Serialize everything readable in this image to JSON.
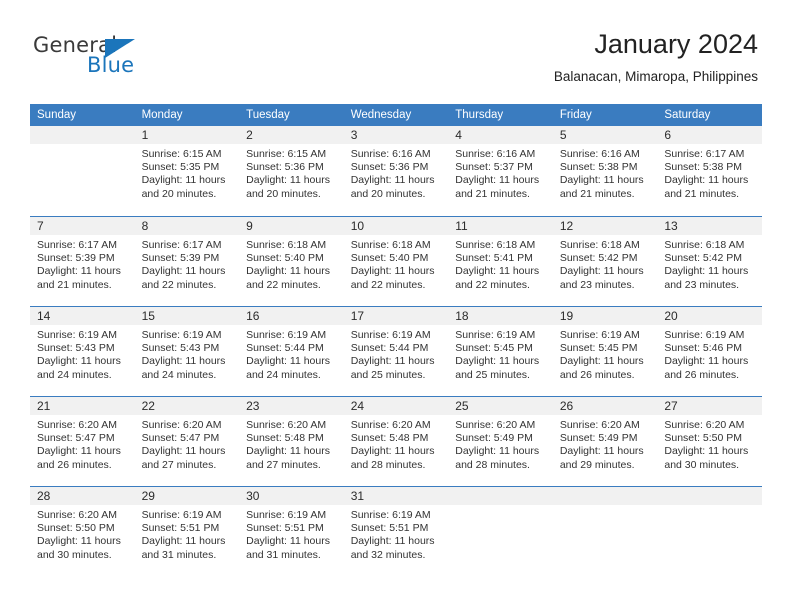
{
  "brand": {
    "name_top": "General",
    "name_bottom": "Blue",
    "triangle_icon": "triangle-icon",
    "accent_color": "#1b75bb"
  },
  "header": {
    "title": "January 2024",
    "subtitle": "Balanacan, Mimaropa, Philippines"
  },
  "theme": {
    "header_row_bg": "#3a7cc0",
    "daynum_band_bg": "#f1f1f1",
    "grid_line": "#3a7cc0",
    "text": "#333333"
  },
  "calendar": {
    "weekday_headers": [
      "Sunday",
      "Monday",
      "Tuesday",
      "Wednesday",
      "Thursday",
      "Friday",
      "Saturday"
    ],
    "weeks": [
      [
        {
          "day": "",
          "lines": []
        },
        {
          "day": "1",
          "lines": [
            "Sunrise: 6:15 AM",
            "Sunset: 5:35 PM",
            "Daylight: 11 hours",
            "and 20 minutes."
          ]
        },
        {
          "day": "2",
          "lines": [
            "Sunrise: 6:15 AM",
            "Sunset: 5:36 PM",
            "Daylight: 11 hours",
            "and 20 minutes."
          ]
        },
        {
          "day": "3",
          "lines": [
            "Sunrise: 6:16 AM",
            "Sunset: 5:36 PM",
            "Daylight: 11 hours",
            "and 20 minutes."
          ]
        },
        {
          "day": "4",
          "lines": [
            "Sunrise: 6:16 AM",
            "Sunset: 5:37 PM",
            "Daylight: 11 hours",
            "and 21 minutes."
          ]
        },
        {
          "day": "5",
          "lines": [
            "Sunrise: 6:16 AM",
            "Sunset: 5:38 PM",
            "Daylight: 11 hours",
            "and 21 minutes."
          ]
        },
        {
          "day": "6",
          "lines": [
            "Sunrise: 6:17 AM",
            "Sunset: 5:38 PM",
            "Daylight: 11 hours",
            "and 21 minutes."
          ]
        }
      ],
      [
        {
          "day": "7",
          "lines": [
            "Sunrise: 6:17 AM",
            "Sunset: 5:39 PM",
            "Daylight: 11 hours",
            "and 21 minutes."
          ]
        },
        {
          "day": "8",
          "lines": [
            "Sunrise: 6:17 AM",
            "Sunset: 5:39 PM",
            "Daylight: 11 hours",
            "and 22 minutes."
          ]
        },
        {
          "day": "9",
          "lines": [
            "Sunrise: 6:18 AM",
            "Sunset: 5:40 PM",
            "Daylight: 11 hours",
            "and 22 minutes."
          ]
        },
        {
          "day": "10",
          "lines": [
            "Sunrise: 6:18 AM",
            "Sunset: 5:40 PM",
            "Daylight: 11 hours",
            "and 22 minutes."
          ]
        },
        {
          "day": "11",
          "lines": [
            "Sunrise: 6:18 AM",
            "Sunset: 5:41 PM",
            "Daylight: 11 hours",
            "and 22 minutes."
          ]
        },
        {
          "day": "12",
          "lines": [
            "Sunrise: 6:18 AM",
            "Sunset: 5:42 PM",
            "Daylight: 11 hours",
            "and 23 minutes."
          ]
        },
        {
          "day": "13",
          "lines": [
            "Sunrise: 6:18 AM",
            "Sunset: 5:42 PM",
            "Daylight: 11 hours",
            "and 23 minutes."
          ]
        }
      ],
      [
        {
          "day": "14",
          "lines": [
            "Sunrise: 6:19 AM",
            "Sunset: 5:43 PM",
            "Daylight: 11 hours",
            "and 24 minutes."
          ]
        },
        {
          "day": "15",
          "lines": [
            "Sunrise: 6:19 AM",
            "Sunset: 5:43 PM",
            "Daylight: 11 hours",
            "and 24 minutes."
          ]
        },
        {
          "day": "16",
          "lines": [
            "Sunrise: 6:19 AM",
            "Sunset: 5:44 PM",
            "Daylight: 11 hours",
            "and 24 minutes."
          ]
        },
        {
          "day": "17",
          "lines": [
            "Sunrise: 6:19 AM",
            "Sunset: 5:44 PM",
            "Daylight: 11 hours",
            "and 25 minutes."
          ]
        },
        {
          "day": "18",
          "lines": [
            "Sunrise: 6:19 AM",
            "Sunset: 5:45 PM",
            "Daylight: 11 hours",
            "and 25 minutes."
          ]
        },
        {
          "day": "19",
          "lines": [
            "Sunrise: 6:19 AM",
            "Sunset: 5:45 PM",
            "Daylight: 11 hours",
            "and 26 minutes."
          ]
        },
        {
          "day": "20",
          "lines": [
            "Sunrise: 6:19 AM",
            "Sunset: 5:46 PM",
            "Daylight: 11 hours",
            "and 26 minutes."
          ]
        }
      ],
      [
        {
          "day": "21",
          "lines": [
            "Sunrise: 6:20 AM",
            "Sunset: 5:47 PM",
            "Daylight: 11 hours",
            "and 26 minutes."
          ]
        },
        {
          "day": "22",
          "lines": [
            "Sunrise: 6:20 AM",
            "Sunset: 5:47 PM",
            "Daylight: 11 hours",
            "and 27 minutes."
          ]
        },
        {
          "day": "23",
          "lines": [
            "Sunrise: 6:20 AM",
            "Sunset: 5:48 PM",
            "Daylight: 11 hours",
            "and 27 minutes."
          ]
        },
        {
          "day": "24",
          "lines": [
            "Sunrise: 6:20 AM",
            "Sunset: 5:48 PM",
            "Daylight: 11 hours",
            "and 28 minutes."
          ]
        },
        {
          "day": "25",
          "lines": [
            "Sunrise: 6:20 AM",
            "Sunset: 5:49 PM",
            "Daylight: 11 hours",
            "and 28 minutes."
          ]
        },
        {
          "day": "26",
          "lines": [
            "Sunrise: 6:20 AM",
            "Sunset: 5:49 PM",
            "Daylight: 11 hours",
            "and 29 minutes."
          ]
        },
        {
          "day": "27",
          "lines": [
            "Sunrise: 6:20 AM",
            "Sunset: 5:50 PM",
            "Daylight: 11 hours",
            "and 30 minutes."
          ]
        }
      ],
      [
        {
          "day": "28",
          "lines": [
            "Sunrise: 6:20 AM",
            "Sunset: 5:50 PM",
            "Daylight: 11 hours",
            "and 30 minutes."
          ]
        },
        {
          "day": "29",
          "lines": [
            "Sunrise: 6:19 AM",
            "Sunset: 5:51 PM",
            "Daylight: 11 hours",
            "and 31 minutes."
          ]
        },
        {
          "day": "30",
          "lines": [
            "Sunrise: 6:19 AM",
            "Sunset: 5:51 PM",
            "Daylight: 11 hours",
            "and 31 minutes."
          ]
        },
        {
          "day": "31",
          "lines": [
            "Sunrise: 6:19 AM",
            "Sunset: 5:51 PM",
            "Daylight: 11 hours",
            "and 32 minutes."
          ]
        },
        {
          "day": "",
          "lines": []
        },
        {
          "day": "",
          "lines": []
        },
        {
          "day": "",
          "lines": []
        }
      ]
    ]
  }
}
